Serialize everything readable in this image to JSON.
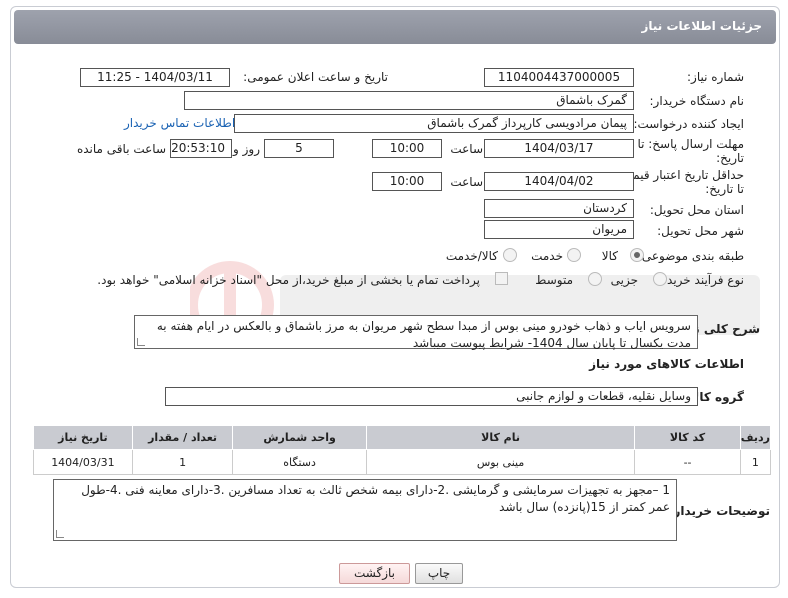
{
  "header": {
    "title": "جزئیات اطلاعات نیاز"
  },
  "fields": {
    "need_number": {
      "label": "شماره نیاز:",
      "value": "1104004437000005"
    },
    "public_announce": {
      "label": "تاریخ و ساعت اعلان عمومی:",
      "value": "1404/03/11 - 11:25"
    },
    "buyer_org": {
      "label": "نام دستگاه خریدار:",
      "value": "گمرک باشماق"
    },
    "requester": {
      "label": "ایجاد کننده درخواست:",
      "value": "پیمان مرادویسی کارپرداز گمرک باشماق",
      "contact_link": "اطلاعات تماس خریدار"
    },
    "reply_deadline": {
      "label": "مهلت ارسال پاسخ: تا تاریخ:",
      "date": "1404/03/17",
      "time_label": "ساعت",
      "time": "10:00",
      "days": "5",
      "days_label": "روز و",
      "remaining": "20:53:10",
      "remaining_label": "ساعت باقی مانده"
    },
    "price_validity": {
      "label": "حداقل تاریخ اعتبار قیمت: تا تاریخ:",
      "date": "1404/04/02",
      "time_label": "ساعت",
      "time": "10:00"
    },
    "province": {
      "label": "استان محل تحویل:",
      "value": "کردستان"
    },
    "city": {
      "label": "شهر محل تحویل:",
      "value": "مریوان"
    },
    "category": {
      "label": "طبقه بندی موضوعی:",
      "options": [
        "کالا",
        "خدمت",
        "کالا/خدمت"
      ],
      "selected": "کالا"
    },
    "process": {
      "label": "نوع فرآیند خرید :",
      "options": [
        "جزیی",
        "متوسط"
      ],
      "payment_note": "پرداخت تمام یا بخشی از مبلغ خرید،از محل \"اسناد خزانه اسلامی\" خواهد بود."
    }
  },
  "description": {
    "label": "شرح کلی نیاز:",
    "text": "سرویس ایاب و ذهاب خودرو مینی بوس از مبدا سطح شهر مریوان به مرز باشماق و بالعکس در ایام هفته به مدت یکسال تا پایان سال 1404- شرایط پیوست میباشد"
  },
  "goods_section": {
    "title": "اطلاعات کالاهای مورد نیاز",
    "group_label": "گروه کالا:",
    "group_value": "وسایل نقلیه، قطعات و لوازم جانبی"
  },
  "table": {
    "headers": [
      "ردیف",
      "کد کالا",
      "نام کالا",
      "واحد شمارش",
      "تعداد / مقدار",
      "تاریخ نیاز"
    ],
    "rows": [
      [
        "1",
        "--",
        "مینی بوس",
        "دستگاه",
        "1",
        "1404/03/31"
      ]
    ]
  },
  "buyer_notes": {
    "label": "توضیحات خریدار:",
    "text": "1 –مجهز به تجهیزات سرمایشی و گرمایشی .2-دارای بیمه شخص ثالث به تعداد مسافرین .3-دارای معاینه فنی .4-طول عمر کمتر از 15(پانزده) سال باشد"
  },
  "buttons": {
    "print": "چاپ",
    "back": "بازگشت"
  },
  "colors": {
    "header": "#8f939e",
    "link": "#1a62b3",
    "table_header": "#c9cbd1"
  }
}
